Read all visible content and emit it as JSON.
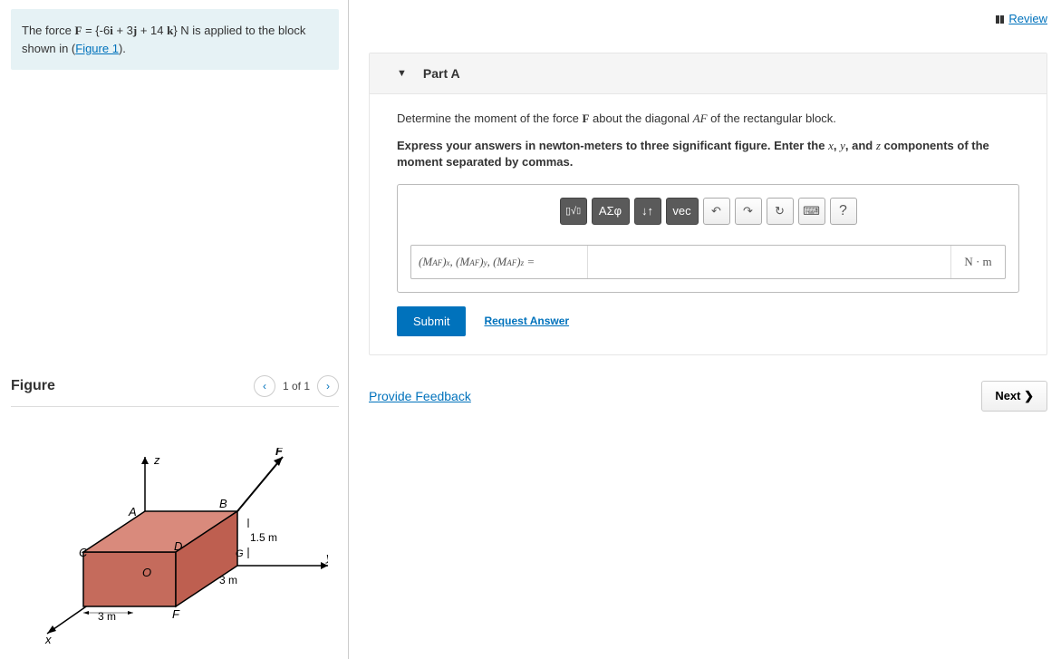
{
  "review": {
    "label": "Review"
  },
  "problem": {
    "prefix": "The force ",
    "force_symbol": "F",
    "equals": " = {-6",
    "i": "i",
    "plus1": " + 3",
    "j": "j",
    "plus2": " + 14 ",
    "k": "k",
    "close": "} N is applied to the block shown in (",
    "figure_link": "Figure 1",
    "end": ")."
  },
  "figure": {
    "title": "Figure",
    "counter": "1 of 1",
    "labels": {
      "z": "z",
      "y": "y",
      "x": "x",
      "A": "A",
      "B": "B",
      "C": "C",
      "D": "D",
      "O": "O",
      "G": "G",
      "F_vec": "F",
      "F_corner": "F",
      "dim15": "1.5 m",
      "dim3_a": "3 m",
      "dim3_b": "3 m"
    }
  },
  "partA": {
    "header": "Part A",
    "question_prefix": "Determine the moment of the force ",
    "F": "F",
    "question_mid": " about the diagonal ",
    "AF": "AF",
    "question_end": " of the rectangular block.",
    "instruction_prefix": "Express your answers in newton-meters to three significant figure. Enter the ",
    "xvar": "x",
    "comma1": ", ",
    "yvar": "y",
    "comma2": ", and ",
    "zvar": "z",
    "instruction_end": " components of the moment separated by commas.",
    "toolbar": {
      "template": "▯√▯",
      "greek": "ΑΣφ",
      "subsup": "↓↑",
      "vec": "vec",
      "undo": "↶",
      "redo": "↷",
      "reset": "↻",
      "keyboard": "⌨",
      "help": "?"
    },
    "label": "(M_AF)_x, (M_AF)_y, (M_AF)_z =",
    "unit": "N · m",
    "submit": "Submit",
    "request": "Request Answer"
  },
  "footer": {
    "feedback": "Provide Feedback",
    "next": "Next ❯"
  }
}
